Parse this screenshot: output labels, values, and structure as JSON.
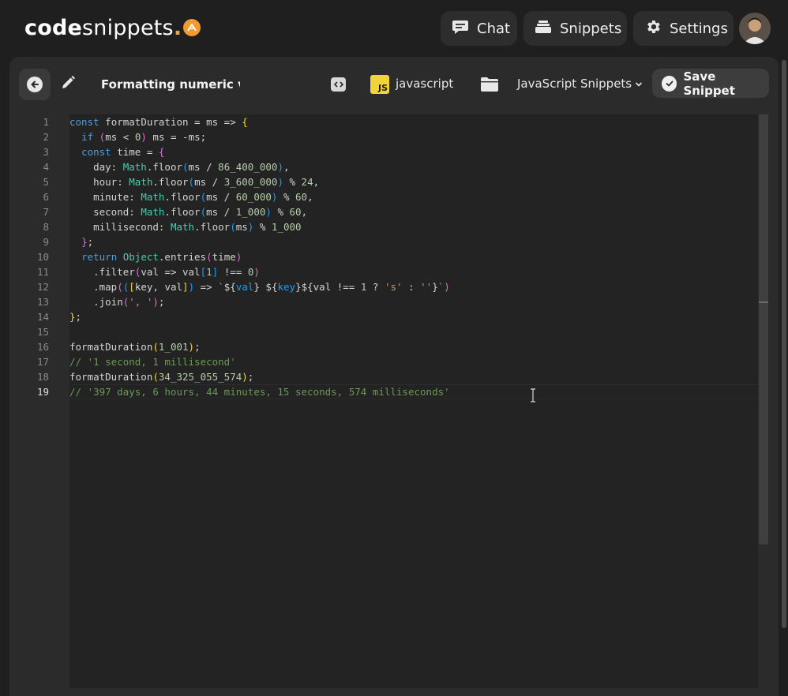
{
  "brand": {
    "name_bold": "code",
    "name_regular": "snippets",
    "dot": ".",
    "accent": "#f29a2e"
  },
  "nav": {
    "items": [
      {
        "label": "Chat",
        "icon": "chat-bubble-icon"
      },
      {
        "label": "Snippets",
        "icon": "stack-icon"
      },
      {
        "label": "Settings",
        "icon": "gear-icon"
      }
    ]
  },
  "toolbar": {
    "title_value": "Formatting numeric val",
    "language": "javascript",
    "language_badge": "JS",
    "folder": "JavaScript Snippets",
    "save_label": "Save Snippet"
  },
  "editor": {
    "active_line": 19,
    "line_numbers": [
      "1",
      "2",
      "3",
      "4",
      "5",
      "6",
      "7",
      "8",
      "9",
      "10",
      "11",
      "12",
      "13",
      "14",
      "15",
      "16",
      "17",
      "18",
      "19"
    ],
    "lines": [
      "const formatDuration = ms => {",
      "  if (ms < 0) ms = -ms;",
      "  const time = {",
      "    day: Math.floor(ms / 86_400_000),",
      "    hour: Math.floor(ms / 3_600_000) % 24,",
      "    minute: Math.floor(ms / 60_000) % 60,",
      "    second: Math.floor(ms / 1_000) % 60,",
      "    millisecond: Math.floor(ms) % 1_000",
      "  };",
      "  return Object.entries(time)",
      "    .filter(val => val[1] !== 0)",
      "    .map(([key, val]) => `${val} ${key}${val !== 1 ? 's' : ''}`)",
      "    .join(', ');",
      "};",
      "",
      "formatDuration(1_001);",
      "// '1 second, 1 millisecond'",
      "formatDuration(34_325_055_574);",
      "// '397 days, 6 hours, 44 minutes, 15 seconds, 574 milliseconds'"
    ]
  },
  "colors": {
    "background": "#1f1f1f",
    "panel": "#2b2b2b",
    "editor": "#232323",
    "keyword": "#569cd6",
    "object": "#4ec9b0",
    "number": "#b5cea8",
    "string": "#ce9178",
    "comment": "#6a9955"
  }
}
